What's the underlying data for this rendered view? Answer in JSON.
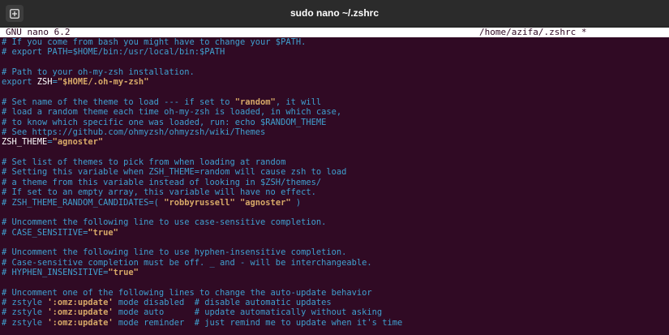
{
  "window": {
    "title": "sudo nano ~/.zshrc",
    "new_tab_icon": "terminal-new-tab-icon"
  },
  "nano": {
    "version": "GNU nano 6.2",
    "file": "/home/azifa/.zshrc *"
  },
  "colors": {
    "background": "#300a24",
    "comment": "#3fa0cf",
    "string": "#d2a055",
    "text": "#ffffff"
  },
  "lines": [
    {
      "parts": [
        {
          "t": "# If you come from bash you might have to change your $PATH.",
          "k": "c"
        }
      ]
    },
    {
      "parts": [
        {
          "t": "# export PATH=$HOME/bin:/usr/local/bin:$PATH",
          "k": "c"
        }
      ]
    },
    {
      "parts": []
    },
    {
      "parts": [
        {
          "t": "# Path to your oh-my-zsh installation.",
          "k": "c"
        }
      ]
    },
    {
      "parts": [
        {
          "t": "export ",
          "k": "c"
        },
        {
          "t": "ZSH",
          "k": "w"
        },
        {
          "t": "=",
          "k": "c"
        },
        {
          "t": "\"$HOME/.oh-my-zsh\"",
          "k": "sb"
        }
      ]
    },
    {
      "parts": []
    },
    {
      "parts": [
        {
          "t": "# Set name of the theme to load --- if set to ",
          "k": "c"
        },
        {
          "t": "\"random\"",
          "k": "sb"
        },
        {
          "t": ", it will",
          "k": "c"
        }
      ]
    },
    {
      "parts": [
        {
          "t": "# load a random theme each time oh-my-zsh is loaded, in which case,",
          "k": "c"
        }
      ]
    },
    {
      "parts": [
        {
          "t": "# to know which specific one was loaded, run: echo $RANDOM_THEME",
          "k": "c"
        }
      ]
    },
    {
      "parts": [
        {
          "t": "# See https://github.com/ohmyzsh/ohmyzsh/wiki/Themes",
          "k": "c"
        }
      ]
    },
    {
      "parts": [
        {
          "t": "ZSH_THEME",
          "k": "w"
        },
        {
          "t": "=",
          "k": "c"
        },
        {
          "t": "\"agnoster\"",
          "k": "sb"
        }
      ]
    },
    {
      "parts": []
    },
    {
      "parts": [
        {
          "t": "# Set list of themes to pick from when loading at random",
          "k": "c"
        }
      ]
    },
    {
      "parts": [
        {
          "t": "# Setting this variable when ZSH_THEME=random will cause zsh to load",
          "k": "c"
        }
      ]
    },
    {
      "parts": [
        {
          "t": "# a theme from this variable instead of looking in $ZSH/themes/",
          "k": "c"
        }
      ]
    },
    {
      "parts": [
        {
          "t": "# If set to an empty array, this variable will have no effect.",
          "k": "c"
        }
      ]
    },
    {
      "parts": [
        {
          "t": "# ZSH_THEME_RANDOM_CANDIDATES=( ",
          "k": "c"
        },
        {
          "t": "\"robbyrussell\" \"agnoster\"",
          "k": "sb"
        },
        {
          "t": " )",
          "k": "c"
        }
      ]
    },
    {
      "parts": []
    },
    {
      "parts": [
        {
          "t": "# Uncomment the following line to use case-sensitive completion.",
          "k": "c"
        }
      ]
    },
    {
      "parts": [
        {
          "t": "# CASE_SENSITIVE=",
          "k": "c"
        },
        {
          "t": "\"true\"",
          "k": "sb"
        }
      ]
    },
    {
      "parts": []
    },
    {
      "parts": [
        {
          "t": "# Uncomment the following line to use hyphen-insensitive completion.",
          "k": "c"
        }
      ]
    },
    {
      "parts": [
        {
          "t": "# Case-sensitive completion must be off. _ and - will be interchangeable.",
          "k": "c"
        }
      ]
    },
    {
      "parts": [
        {
          "t": "# HYPHEN_INSENSITIVE=",
          "k": "c"
        },
        {
          "t": "\"true\"",
          "k": "sb"
        }
      ]
    },
    {
      "parts": []
    },
    {
      "parts": [
        {
          "t": "# Uncomment one of the following lines to change the auto-update behavior",
          "k": "c"
        }
      ]
    },
    {
      "parts": [
        {
          "t": "# zstyle ",
          "k": "c"
        },
        {
          "t": "':omz:update'",
          "k": "sb"
        },
        {
          "t": " mode disabled  # disable automatic updates",
          "k": "c"
        }
      ]
    },
    {
      "parts": [
        {
          "t": "# zstyle ",
          "k": "c"
        },
        {
          "t": "':omz:update'",
          "k": "sb"
        },
        {
          "t": " mode auto      # update automatically without asking",
          "k": "c"
        }
      ]
    },
    {
      "parts": [
        {
          "t": "# zstyle ",
          "k": "c"
        },
        {
          "t": "':omz:update'",
          "k": "sb"
        },
        {
          "t": " mode reminder  # just remind me to update when it's time",
          "k": "c"
        }
      ]
    }
  ]
}
